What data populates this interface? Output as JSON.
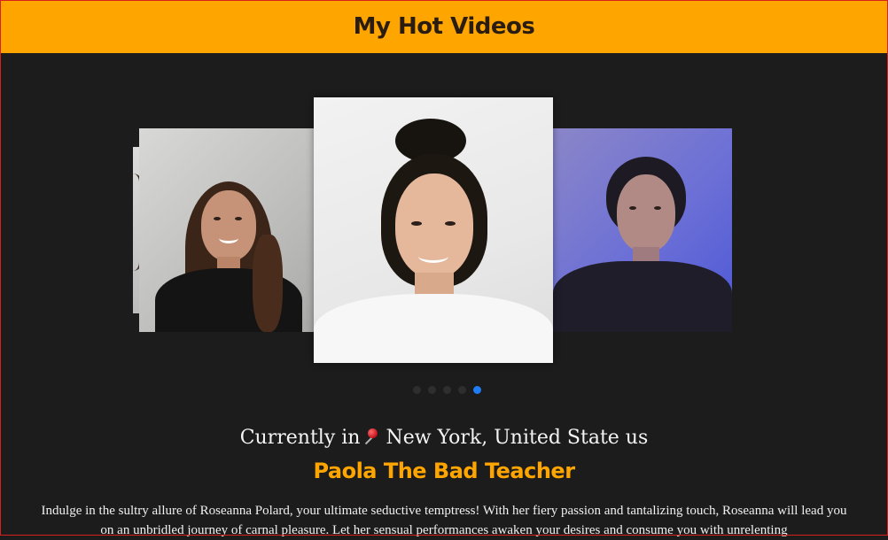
{
  "header": {
    "title": "My Hot Videos"
  },
  "carousel": {
    "slides": [
      {
        "label": "profile-photo-partial"
      },
      {
        "label": "profile-photo-left"
      },
      {
        "label": "profile-photo-center"
      },
      {
        "label": "profile-photo-right"
      }
    ],
    "dots": 5,
    "active_dot": 5
  },
  "location": {
    "prefix": "Currently in",
    "place": " New York, United State us"
  },
  "profile": {
    "name": "Paola The Bad Teacher",
    "bio": "Indulge in the sultry allure of Roseanna Polard, your ultimate seductive temptress! With her fiery passion and tantalizing touch, Roseanna will lead you on an unbridled journey of carnal pleasure. Let her sensual performances awaken your desires and consume you with unrelenting"
  },
  "colors": {
    "header_bg": "#ffa500",
    "page_bg": "#1c1c1c",
    "name_color": "#ffa500",
    "active_dot": "#1e7df5",
    "frame_border": "#d4211c"
  },
  "icons": {
    "location_pin": "pushpin-icon"
  }
}
